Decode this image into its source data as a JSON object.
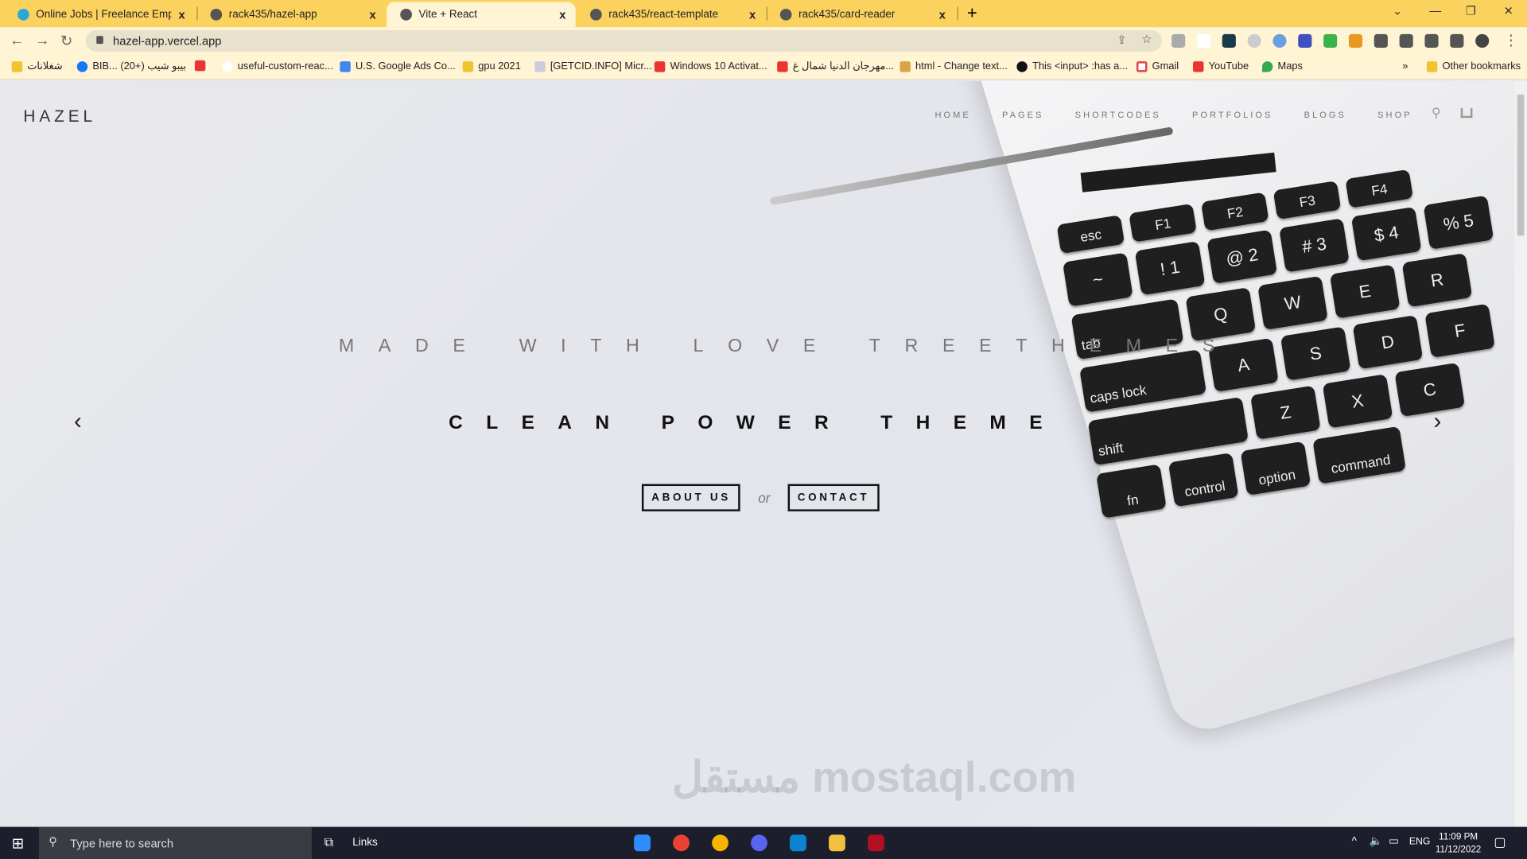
{
  "browser": {
    "tabs": [
      {
        "title": "Online Jobs | Freelance Employm",
        "active": false
      },
      {
        "title": "rack435/hazel-app",
        "active": false
      },
      {
        "title": "Vite + React",
        "active": true
      },
      {
        "title": "rack435/react-template",
        "active": false
      },
      {
        "title": "rack435/card-reader",
        "active": false
      }
    ],
    "close_glyph": "x",
    "new_tab": "+",
    "url": "hazel-app.vercel.app",
    "bookmarks": [
      "شغلانات",
      "BIB... بيبو شيب (+20)",
      "",
      "useful-custom-reac...",
      "U.S. Google Ads Co...",
      "gpu 2021",
      "[GETCID.INFO] Micr...",
      "Windows 10 Activat...",
      "مهرجان الدنيا شمال غ...",
      "html - Change text...",
      "This <input> :has a...",
      "Gmail",
      "YouTube",
      "Maps"
    ],
    "other_bookmarks": "Other bookmarks",
    "overflow": "»"
  },
  "site": {
    "brand": "HAZEL",
    "menu": [
      "HOME",
      "PAGES",
      "SHORTCODES",
      "PORTFOLIOS",
      "BLOGS",
      "SHOP"
    ],
    "tagline": "MADE WITH LOVE TREETHEMES",
    "headline": "CLEAN POWER THEME",
    "about_btn": "ABOUT US",
    "or": "or",
    "contact_btn": "CONTACT",
    "prev": "‹",
    "next": "›",
    "keyboard": [
      [
        "esc",
        "F1",
        "F2",
        "F3",
        "F4"
      ],
      [
        "~",
        "! 1",
        "@ 2",
        "# 3",
        "$ 4",
        "% 5"
      ],
      [
        "tab",
        "Q",
        "W",
        "E",
        "R"
      ],
      [
        "caps lock",
        "A",
        "S",
        "D",
        "F"
      ],
      [
        "shift",
        "Z",
        "X",
        "C"
      ],
      [
        "fn",
        "control",
        "option",
        "command"
      ]
    ]
  },
  "watermark": "مستقل mostaql.com",
  "taskbar": {
    "search_placeholder": "Type here to search",
    "links": "Links",
    "lang": "ENG",
    "time": "11:09 PM",
    "date": "11/12/2022"
  }
}
